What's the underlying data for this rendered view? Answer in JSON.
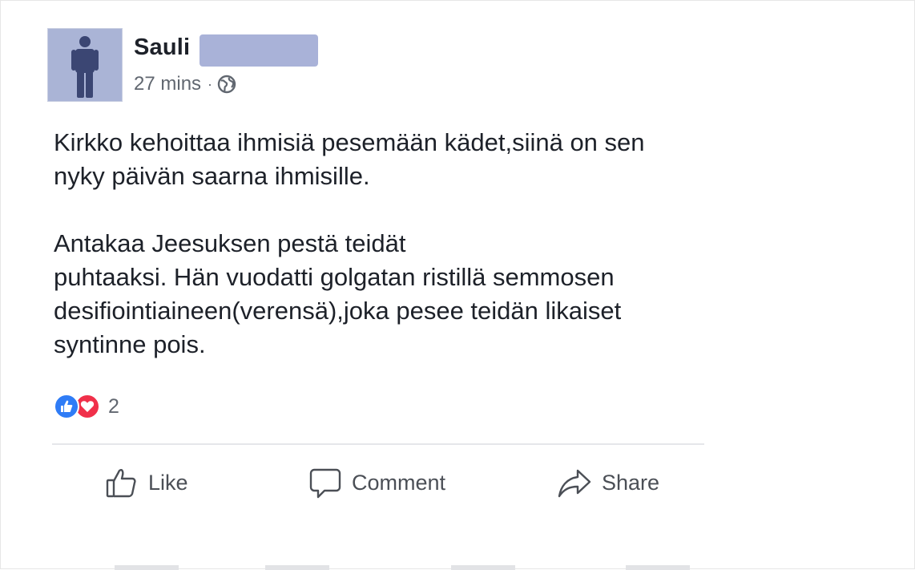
{
  "post": {
    "author_name": "Sauli",
    "timestamp": "27 mins",
    "separator": "·",
    "privacy_icon": "globe-icon",
    "avatar_icon": "person-silhouette-icon",
    "paragraphs": [
      "Kirkko kehoittaa ihmisiä pesemään kädet,siinä on sen nyky päivän saarna ihmisille.",
      "Antakaa Jeesuksen pestä teidät puhtaaksi. Hän vuodatti golgatan ristillä semmosen desifiointiaineen(verensä),joka pesee teidän likaiset syntinne pois."
    ],
    "paragraph_lines": [
      [
        "Kirkko kehoittaa ihmisiä pesemään kädet,siinä on sen",
        "nyky päivän saarna ihmisille."
      ],
      [
        "Antakaa Jeesuksen pestä teidät",
        "puhtaaksi. Hän vuodatti golgatan ristillä semmosen",
        "desifiointiaineen(verensä),joka pesee teidän likaiset",
        "syntinne pois."
      ]
    ],
    "reactions": {
      "icons": [
        "like-reaction-icon",
        "love-reaction-icon"
      ],
      "count": "2"
    }
  },
  "actions": {
    "like_label": "Like",
    "comment_label": "Comment",
    "share_label": "Share"
  },
  "colors": {
    "avatar_bg": "#aab4d6",
    "like_blue": "#2f7cf6",
    "love_red": "#f0304a",
    "text": "#1d2129",
    "meta": "#616770"
  }
}
